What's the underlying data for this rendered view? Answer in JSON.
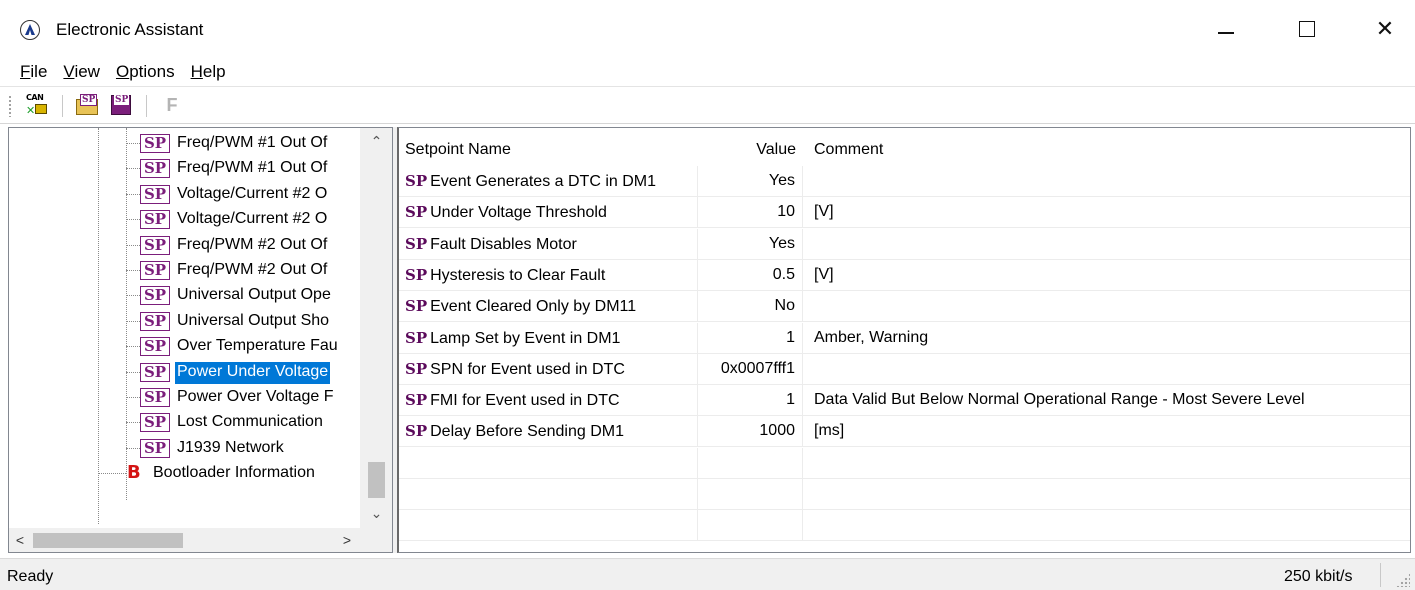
{
  "window": {
    "title": "Electronic Assistant",
    "close_glyph": "✕"
  },
  "menu": [
    {
      "label": "File",
      "accel": "F",
      "rest": "ile"
    },
    {
      "label": "View",
      "accel": "V",
      "rest": "iew"
    },
    {
      "label": "Options",
      "accel": "O",
      "rest": "ptions"
    },
    {
      "label": "Help",
      "accel": "H",
      "rest": "elp"
    }
  ],
  "toolbar": {
    "can_label": "CAN",
    "can_mark": "✕",
    "open_label": "SP",
    "save_label": "SP",
    "f_label": "F"
  },
  "tree": {
    "icon_label": "SP",
    "items": [
      {
        "label": "Freq/PWM #1 Out Of"
      },
      {
        "label": "Freq/PWM #1 Out Of"
      },
      {
        "label": "Voltage/Current #2 O"
      },
      {
        "label": "Voltage/Current #2 O"
      },
      {
        "label": "Freq/PWM #2 Out Of"
      },
      {
        "label": "Freq/PWM #2 Out Of"
      },
      {
        "label": "Universal Output Ope"
      },
      {
        "label": "Universal Output Sho"
      },
      {
        "label": "Over Temperature Fau"
      },
      {
        "label": "Power Under Voltage",
        "selected": true
      },
      {
        "label": "Power Over Voltage F"
      },
      {
        "label": "Lost Communication"
      },
      {
        "label": "J1939 Network"
      }
    ],
    "bootloader": {
      "icon": "B",
      "label": "Bootloader Information"
    },
    "scroll_up": "⌃",
    "scroll_down": "⌄",
    "scroll_left": "<",
    "scroll_right": ">"
  },
  "grid": {
    "columns": {
      "name": "Setpoint Name",
      "value": "Value",
      "comment": "Comment"
    },
    "sp_tag": "SP",
    "rows": [
      {
        "name": "Event Generates a DTC in DM1",
        "value": "Yes",
        "comment": ""
      },
      {
        "name": "Under Voltage Threshold",
        "value": "10",
        "comment": "[V]"
      },
      {
        "name": "Fault Disables Motor",
        "value": "Yes",
        "comment": ""
      },
      {
        "name": "Hysteresis to Clear Fault",
        "value": "0.5",
        "comment": "[V]"
      },
      {
        "name": "Event Cleared Only by DM11",
        "value": "No",
        "comment": ""
      },
      {
        "name": "Lamp Set by Event in DM1",
        "value": "1",
        "comment": "Amber, Warning"
      },
      {
        "name": "SPN for Event used in DTC",
        "value": "0x0007fff1",
        "comment": ""
      },
      {
        "name": "FMI for Event used in DTC",
        "value": "1",
        "comment": "Data Valid But Below Normal Operational Range - Most Severe Level"
      },
      {
        "name": "Delay Before Sending DM1",
        "value": "1000",
        "comment": "[ms]"
      }
    ],
    "empty_rows": 3
  },
  "status": {
    "text": "Ready",
    "bitrate": "250 kbit/s"
  },
  "colors": {
    "selection": "#0078d7",
    "sp_purple": "#7b1e7b",
    "bootloader_red": "#d41414"
  }
}
